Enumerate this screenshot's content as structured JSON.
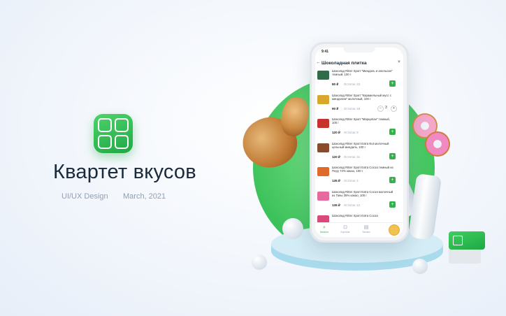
{
  "brand": {
    "title": "Квартет вкусов",
    "tag": "UI/UX Design",
    "date": "March, 2021",
    "icon_name": "quartet-app-icon",
    "accent": "#33b24c"
  },
  "phone": {
    "time": "9:41",
    "header_title": "Шоколадная плитка",
    "items": [
      {
        "name": "Шоколад Ritter Sport \"Миндаль и апельсин\" темный, 100 г",
        "price": "80 ₽",
        "stock": "Остаток: 23",
        "thumb": "#2f6d49",
        "control": "plus"
      },
      {
        "name": "Шоколад Ritter Sport \"Карамельный мусс с миндалем\" молочный, 100 г",
        "price": "90 ₽",
        "stock": "Остаток: 18",
        "thumb": "#d9a72b",
        "control": "stepper",
        "qty": "3"
      },
      {
        "name": "Шоколад Ritter Sport \"Марципан\" темный, 100 г",
        "price": "120 ₽",
        "stock": "Остаток: 8",
        "thumb": "#c8322d",
        "control": "plus"
      },
      {
        "name": "Шоколад Ritter Sport Extra Nut молочный цельный миндаль, 100 г",
        "price": "120 ₽",
        "stock": "Остаток: 31",
        "thumb": "#8b4b2a",
        "control": "plus"
      },
      {
        "name": "Шоколад Ritter Sport Extra Cocoa темный из Перу 74% какао, 100 г",
        "price": "135 ₽",
        "stock": "Остаток: 4",
        "thumb": "#e06a2a",
        "control": "plus"
      },
      {
        "name": "Шоколад Ritter Sport Extra Cocoa молочный из Ганы 35% какао, 100 г",
        "price": "135 ₽",
        "stock": "Остаток: 12",
        "thumb": "#e56aa0",
        "control": "plus"
      },
      {
        "name": "Шоколад Ritter Sport Extra Cocoa",
        "price": "",
        "stock": "",
        "thumb": "#d94a7a",
        "control": "none"
      }
    ],
    "tabs": [
      {
        "label": "Каталог",
        "icon": "search-icon",
        "glyph": "⌕",
        "active": true
      },
      {
        "label": "Корзина",
        "icon": "basket-icon",
        "glyph": "⊡",
        "active": false
      },
      {
        "label": "Заказы",
        "icon": "orders-icon",
        "glyph": "▤",
        "active": false
      }
    ]
  }
}
